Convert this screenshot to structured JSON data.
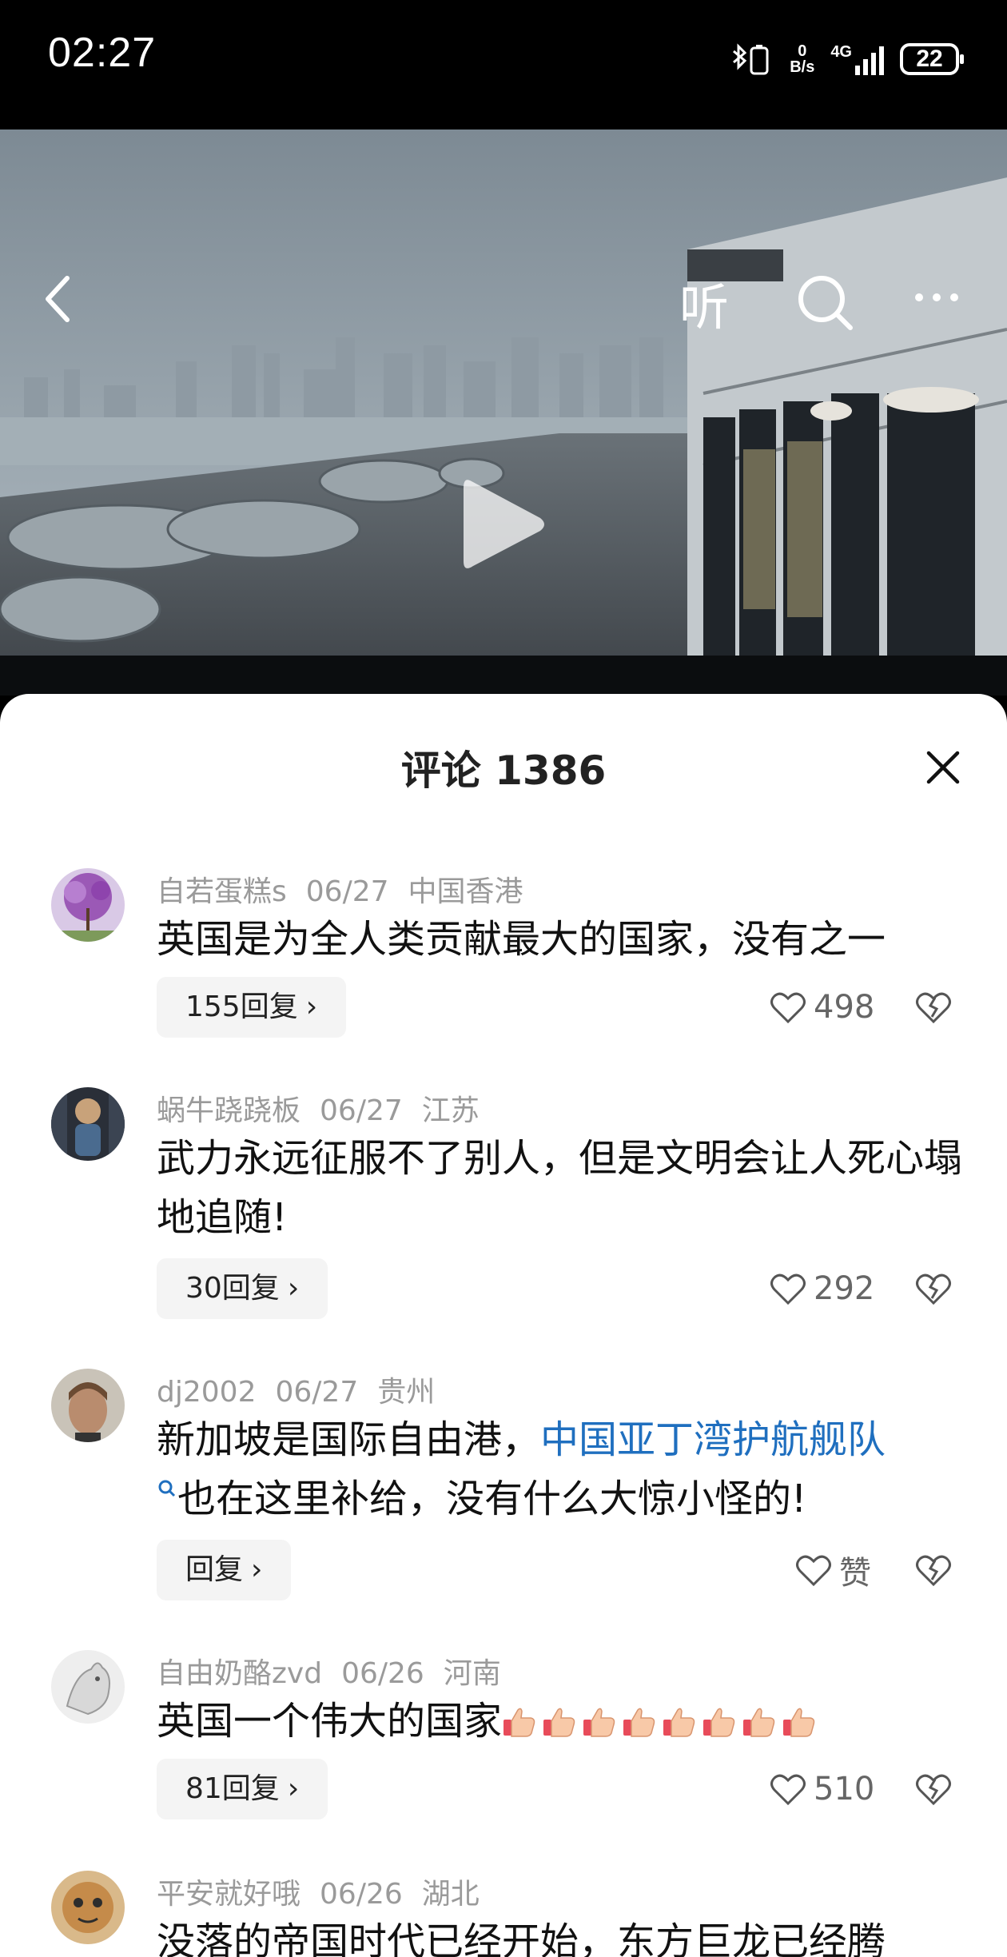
{
  "status_bar": {
    "time": "02:27",
    "net_speed_value": "0",
    "net_speed_unit": "B/s",
    "signal": "4G",
    "battery": "22"
  },
  "video": {
    "listen_label": "听",
    "icons": [
      "back-icon",
      "listen-icon",
      "search-icon",
      "more-icon",
      "play-icon"
    ]
  },
  "comments_panel": {
    "title": "评论 1386",
    "comments": [
      {
        "user": "自若蛋糕s",
        "date": "06/27",
        "location": "中国香港",
        "text": "英国是为全人类贡献最大的国家，没有之一",
        "reply_label": "155回复",
        "likes": "498"
      },
      {
        "user": "蜗牛跷跷板",
        "date": "06/27",
        "location": "江苏",
        "text": "武力永远征服不了别人，但是文明会让人死心塌地追随!",
        "reply_label": "30回复",
        "likes": "292"
      },
      {
        "user": "dj2002",
        "date": "06/27",
        "location": "贵州",
        "text_before": "新加坡是国际自由港，",
        "text_link": "中国亚丁湾护航舰队",
        "text_after": "也在这里补给，没有什么大惊小怪的!",
        "reply_label": "回复",
        "likes": "赞"
      },
      {
        "user": "自由奶酪zvd",
        "date": "06/26",
        "location": "河南",
        "text": "英国一个伟大的国家",
        "emoji": "thumbs-up x8",
        "reply_label": "81回复",
        "likes": "510"
      },
      {
        "user": "平安就好哦",
        "date": "06/26",
        "location": "湖北",
        "text": "没落的帝国时代已经开始，东方巨龙已经腾"
      }
    ]
  },
  "colors": {
    "link": "#1f6fbf",
    "meta": "#9a9a9a",
    "reply_bg": "#f4f4f4"
  }
}
